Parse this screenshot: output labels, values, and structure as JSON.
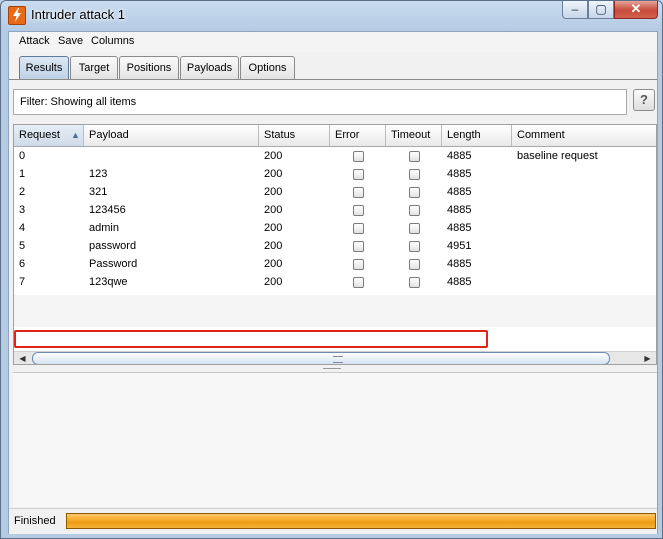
{
  "window": {
    "title": "Intruder attack 1",
    "minimize_glyph": "–",
    "maximize_glyph": "▢",
    "close_glyph": "✕"
  },
  "menu": [
    "Attack",
    "Save",
    "Columns"
  ],
  "tabs": [
    {
      "label": "Results",
      "active": true
    },
    {
      "label": "Target",
      "active": false
    },
    {
      "label": "Positions",
      "active": false
    },
    {
      "label": "Payloads",
      "active": false
    },
    {
      "label": "Options",
      "active": false
    }
  ],
  "filter": {
    "text": "Filter:  Showing all items",
    "help_label": "?"
  },
  "table": {
    "columns": [
      "Request",
      "Payload",
      "Status",
      "Error",
      "Timeout",
      "Length",
      "Comment"
    ],
    "sort_indicator": "▲",
    "rows": [
      {
        "request": "0",
        "payload": "",
        "status": "200",
        "error": false,
        "timeout": false,
        "length": "4885",
        "comment": "baseline request"
      },
      {
        "request": "1",
        "payload": "123",
        "status": "200",
        "error": false,
        "timeout": false,
        "length": "4885",
        "comment": ""
      },
      {
        "request": "2",
        "payload": "321",
        "status": "200",
        "error": false,
        "timeout": false,
        "length": "4885",
        "comment": ""
      },
      {
        "request": "3",
        "payload": "123456",
        "status": "200",
        "error": false,
        "timeout": false,
        "length": "4885",
        "comment": ""
      },
      {
        "request": "4",
        "payload": "admin",
        "status": "200",
        "error": false,
        "timeout": false,
        "length": "4885",
        "comment": ""
      },
      {
        "request": "5",
        "payload": "password",
        "status": "200",
        "error": false,
        "timeout": false,
        "length": "4951",
        "comment": "",
        "highlighted": true
      },
      {
        "request": "6",
        "payload": "Password",
        "status": "200",
        "error": false,
        "timeout": false,
        "length": "4885",
        "comment": ""
      },
      {
        "request": "7",
        "payload": "123qwe",
        "status": "200",
        "error": false,
        "timeout": false,
        "length": "4885",
        "comment": ""
      }
    ]
  },
  "scroll": {
    "left_glyph": "◀",
    "right_glyph": "▶"
  },
  "status": {
    "text": "Finished",
    "progress": 1.0
  },
  "colors": {
    "highlight": "#e2231a",
    "progress": "#ef9d12",
    "accent": "#e86a17"
  }
}
